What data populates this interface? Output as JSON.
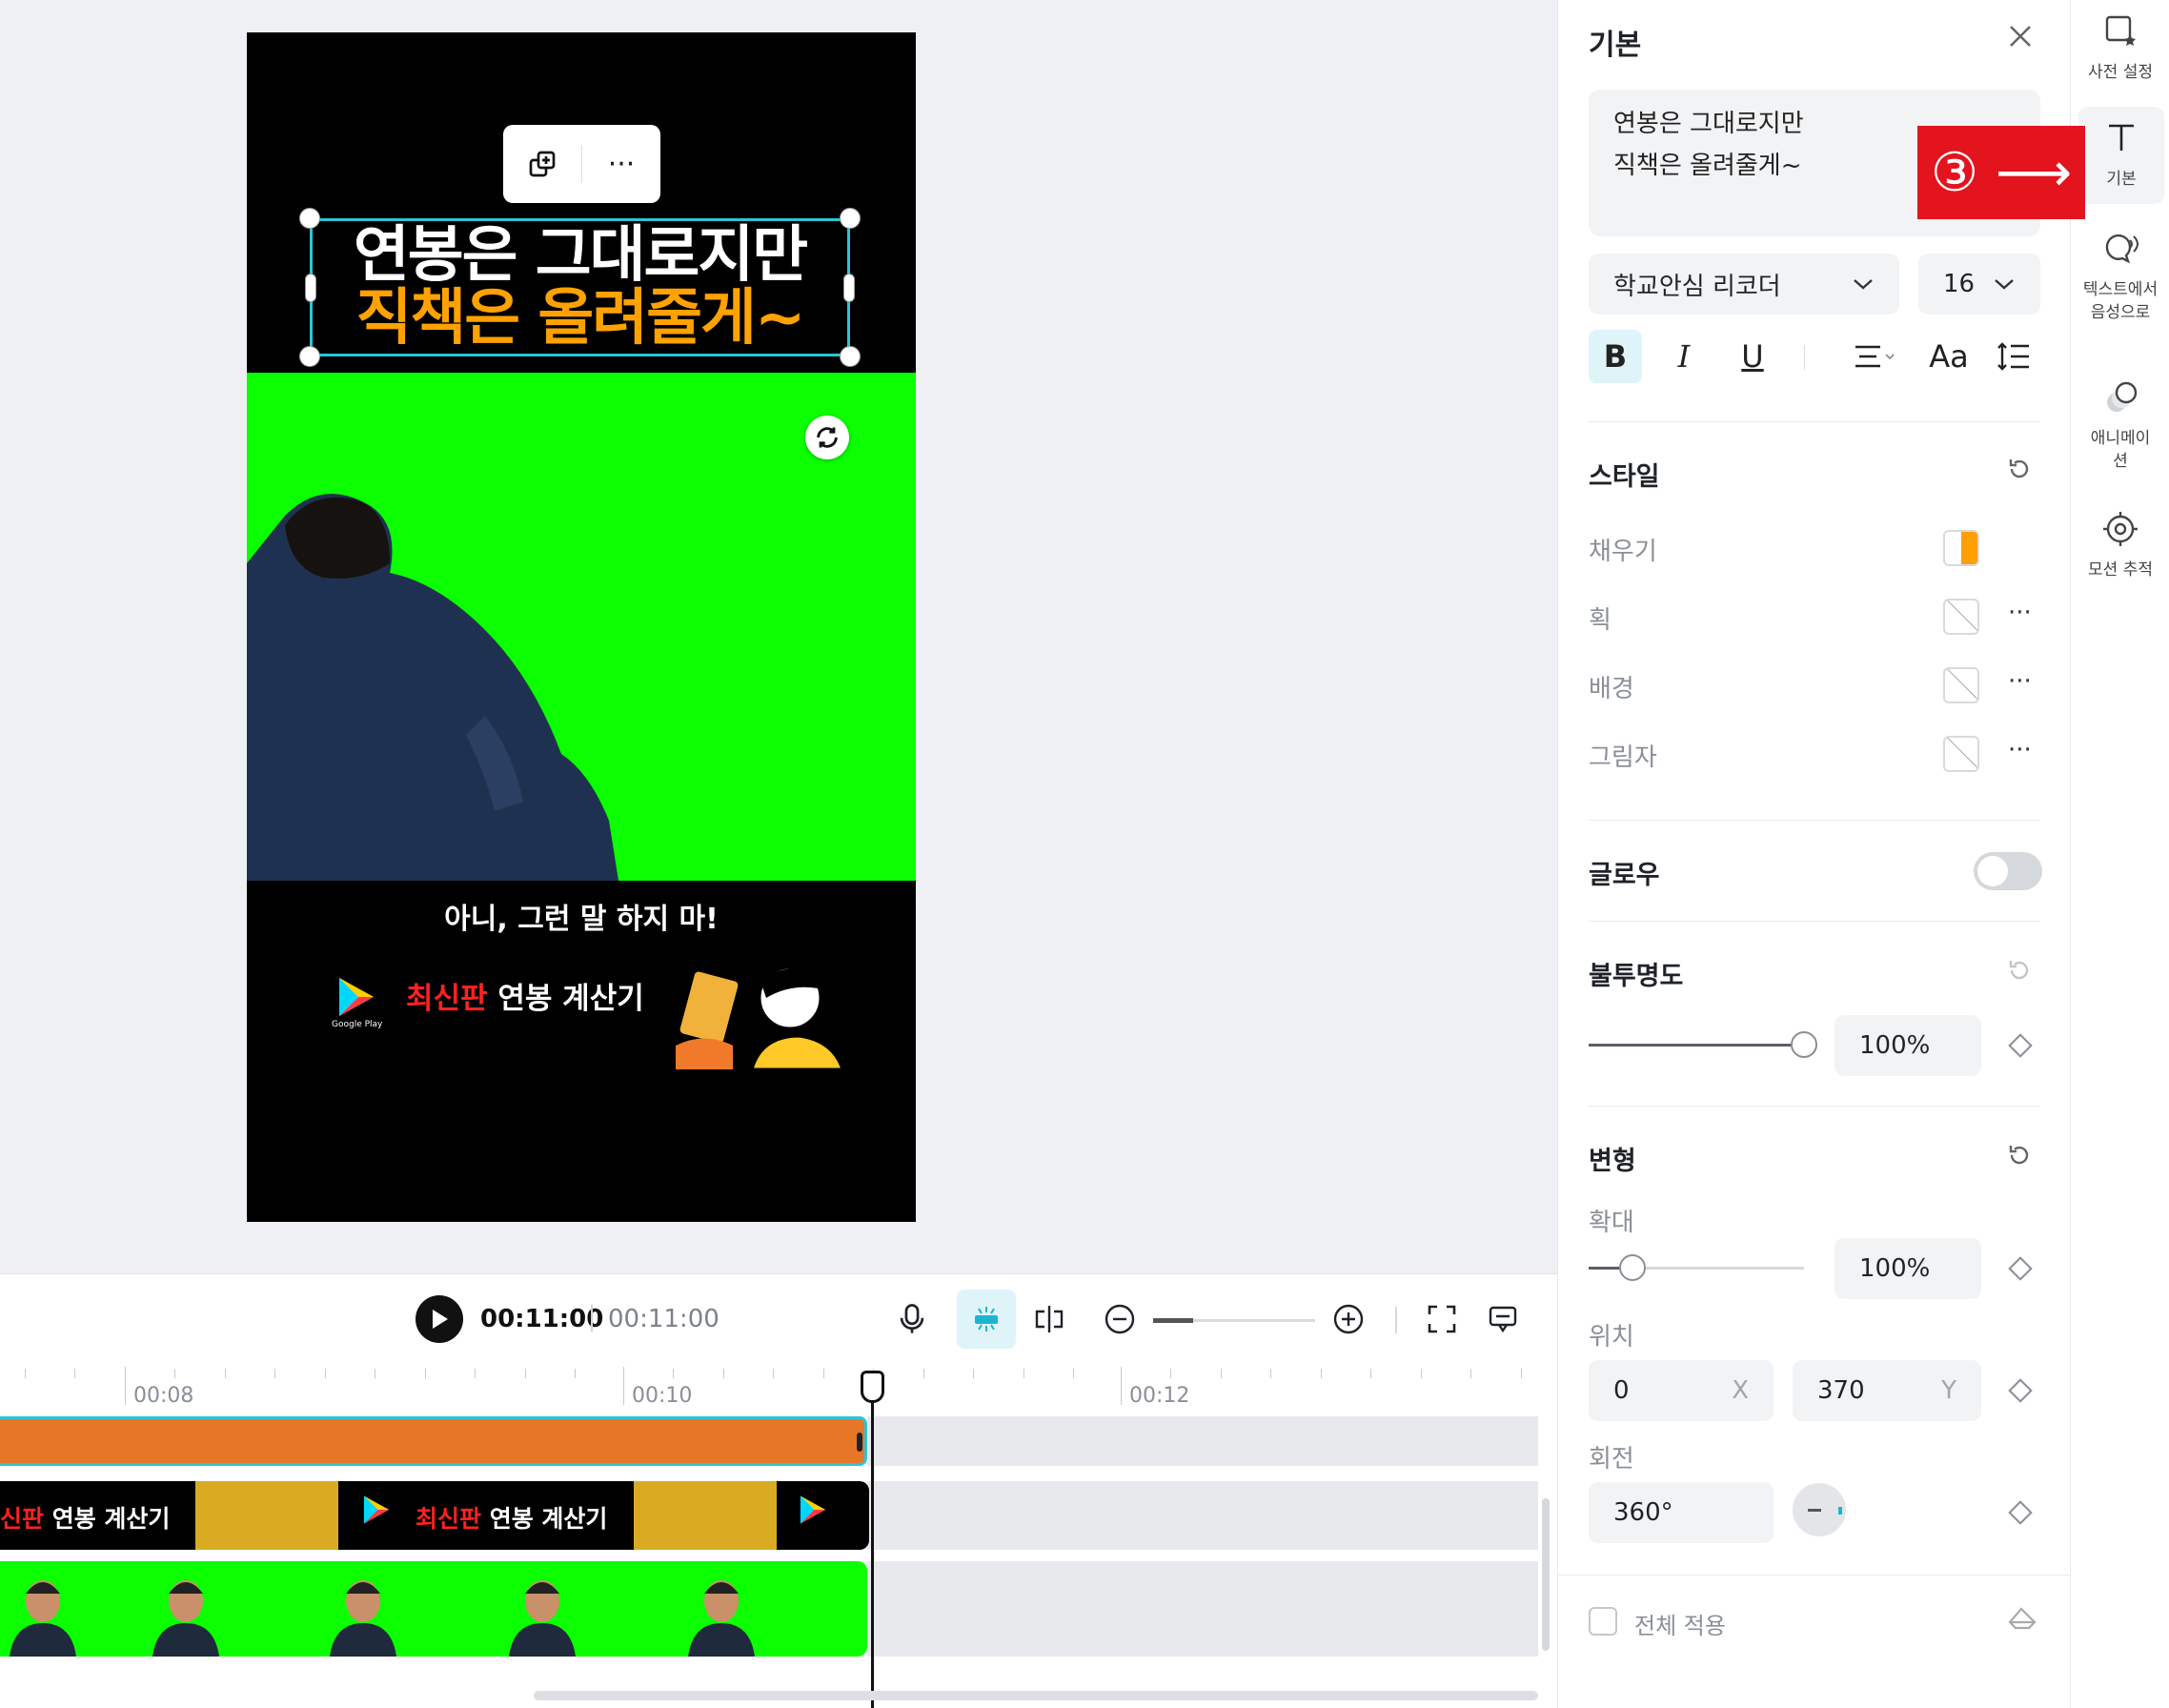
{
  "preview": {
    "title_line1": "연봉은 그대로지만",
    "title_line2": "직책은 올려줄게~",
    "subtitle": "아니, 그런 말 하지 마!",
    "ad_brand_small": "Google Play",
    "ad_text_red": "최신판",
    "ad_text_white": " 연봉 계산기",
    "popmenu_more": "···"
  },
  "playback": {
    "current_time": "00:11:00",
    "total_time": "00:11:00"
  },
  "timeline": {
    "ruler_labels": [
      "00:08",
      "00:10",
      "00:12"
    ],
    "ad_clip_text_red": "최신판",
    "ad_clip_text_white": " 연봉 계산기",
    "ad_clip_partial": "신판"
  },
  "panel": {
    "title": "기본",
    "text_value": "연봉은 그대로지만\n직책은 올려줄게~",
    "font": "학교안심 리코더",
    "font_size": "16",
    "format_buttons": [
      "B",
      "I",
      "U",
      "Aa"
    ],
    "style_section": "스타일",
    "fill_label": "채우기",
    "stroke_label": "획",
    "background_label": "배경",
    "shadow_label": "그림자",
    "glow_label": "글로우",
    "glow_on": false,
    "opacity_section": "불투명도",
    "opacity_value": "100%",
    "opacity_level": 1.0,
    "transform_section": "변형",
    "scale_label": "확대",
    "scale_value": "100%",
    "position_label": "위치",
    "pos_x": "0",
    "pos_x_unit": "X",
    "pos_y": "370",
    "pos_y_unit": "Y",
    "rotation_label": "회전",
    "rotation_value": "360°",
    "apply_all_label": "전체 적용",
    "fill_colors": [
      "#ffffff",
      "#ff9f00"
    ]
  },
  "rail": {
    "items": [
      {
        "label": "사전 설정",
        "icon": "preset-icon"
      },
      {
        "label": "기본",
        "icon": "text-icon"
      },
      {
        "label": "텍스트에서 음성으로",
        "icon": "text-to-speech-icon"
      },
      {
        "label": "애니메이션",
        "icon": "animation-icon"
      },
      {
        "label": "모션 추적",
        "icon": "motion-tracking-icon"
      }
    ]
  },
  "annotation": {
    "text": "③ ⟶"
  },
  "colors": {
    "accent": "#2ac6d6",
    "annotation_red": "#e3141e",
    "title_yellow": "#ffa200",
    "chroma_green": "#0bff00",
    "clip_orange": "#e87627"
  }
}
